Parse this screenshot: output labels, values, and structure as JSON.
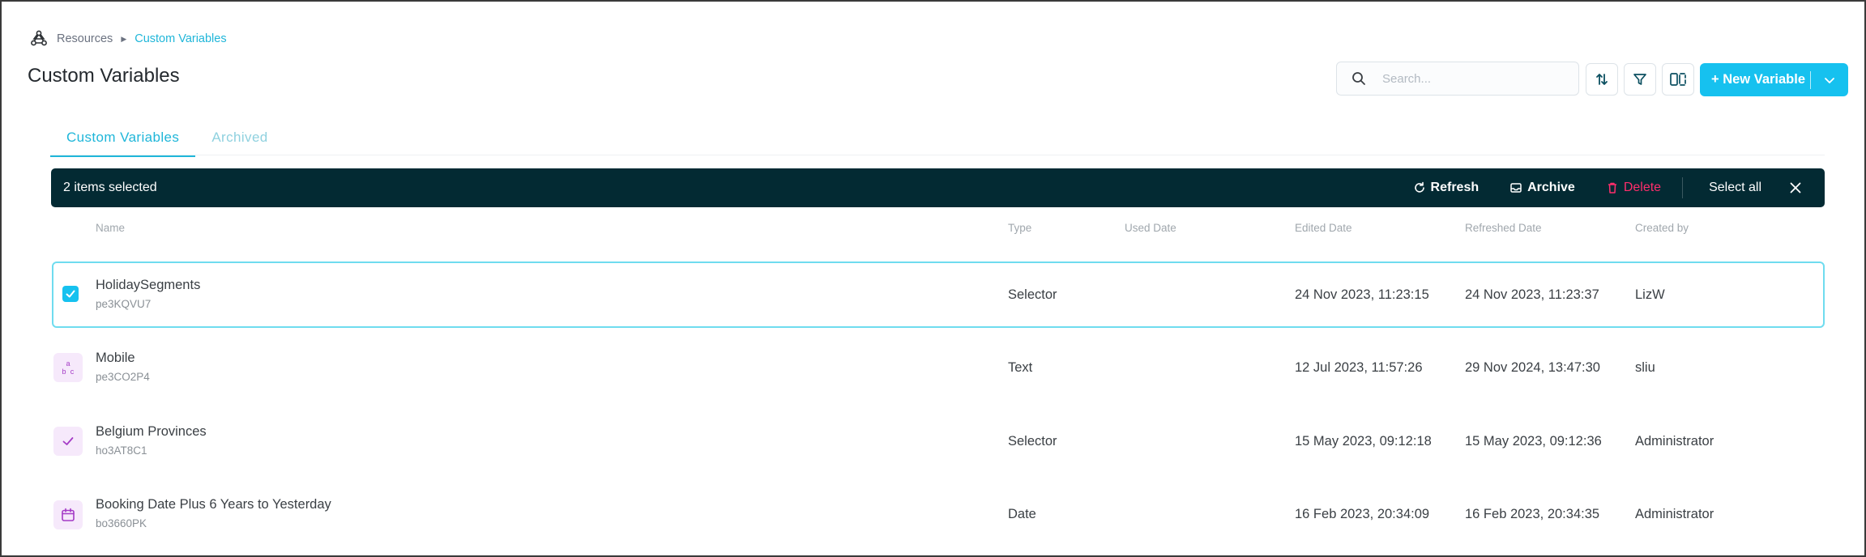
{
  "breadcrumb": {
    "root": "Resources",
    "current": "Custom Variables"
  },
  "page_title": "Custom Variables",
  "search": {
    "placeholder": "Search..."
  },
  "new_button": {
    "label": "+ New Variable"
  },
  "tabs": [
    {
      "label": "Custom Variables",
      "active": true
    },
    {
      "label": "Archived",
      "active": false
    }
  ],
  "selection_bar": {
    "count_text": "2 items selected",
    "refresh": "Refresh",
    "archive": "Archive",
    "delete": "Delete",
    "select_all": "Select all"
  },
  "columns": {
    "name": "Name",
    "type": "Type",
    "used": "Used Date",
    "edited": "Edited Date",
    "refreshed": "Refreshed Date",
    "created": "Created by"
  },
  "rows": [
    {
      "name": "HolidaySegments",
      "id": "pe3KQVU7",
      "type": "Selector",
      "used": "",
      "edited": "24 Nov 2023, 11:23:15",
      "refreshed": "24 Nov 2023, 11:23:37",
      "created": "LizW",
      "icon": "checkbox-checked-icon",
      "selected": true
    },
    {
      "name": "Mobile",
      "id": "pe3CO2P4",
      "type": "Text",
      "used": "",
      "edited": "12 Jul 2023, 11:57:26",
      "refreshed": "29 Nov 2024, 13:47:30",
      "created": "sliu",
      "icon": "text-abc-icon",
      "selected": false
    },
    {
      "name": "Belgium Provinces",
      "id": "ho3AT8C1",
      "type": "Selector",
      "used": "",
      "edited": "15 May 2023, 09:12:18",
      "refreshed": "15 May 2023, 09:12:36",
      "created": "Administrator",
      "icon": "check-icon",
      "selected": false
    },
    {
      "name": "Booking Date Plus 6 Years to Yesterday",
      "id": "bo3660PK",
      "type": "Date",
      "used": "",
      "edited": "16 Feb 2023, 20:34:09",
      "refreshed": "16 Feb 2023, 20:34:35",
      "created": "Administrator",
      "icon": "calendar-icon",
      "selected": false
    }
  ],
  "colors": {
    "accent": "#16c1ef",
    "dark_bar": "#032a33",
    "delete": "#ff2e6c",
    "icon_bg": "#f6e9fb",
    "icon_fg": "#a43bc6"
  }
}
